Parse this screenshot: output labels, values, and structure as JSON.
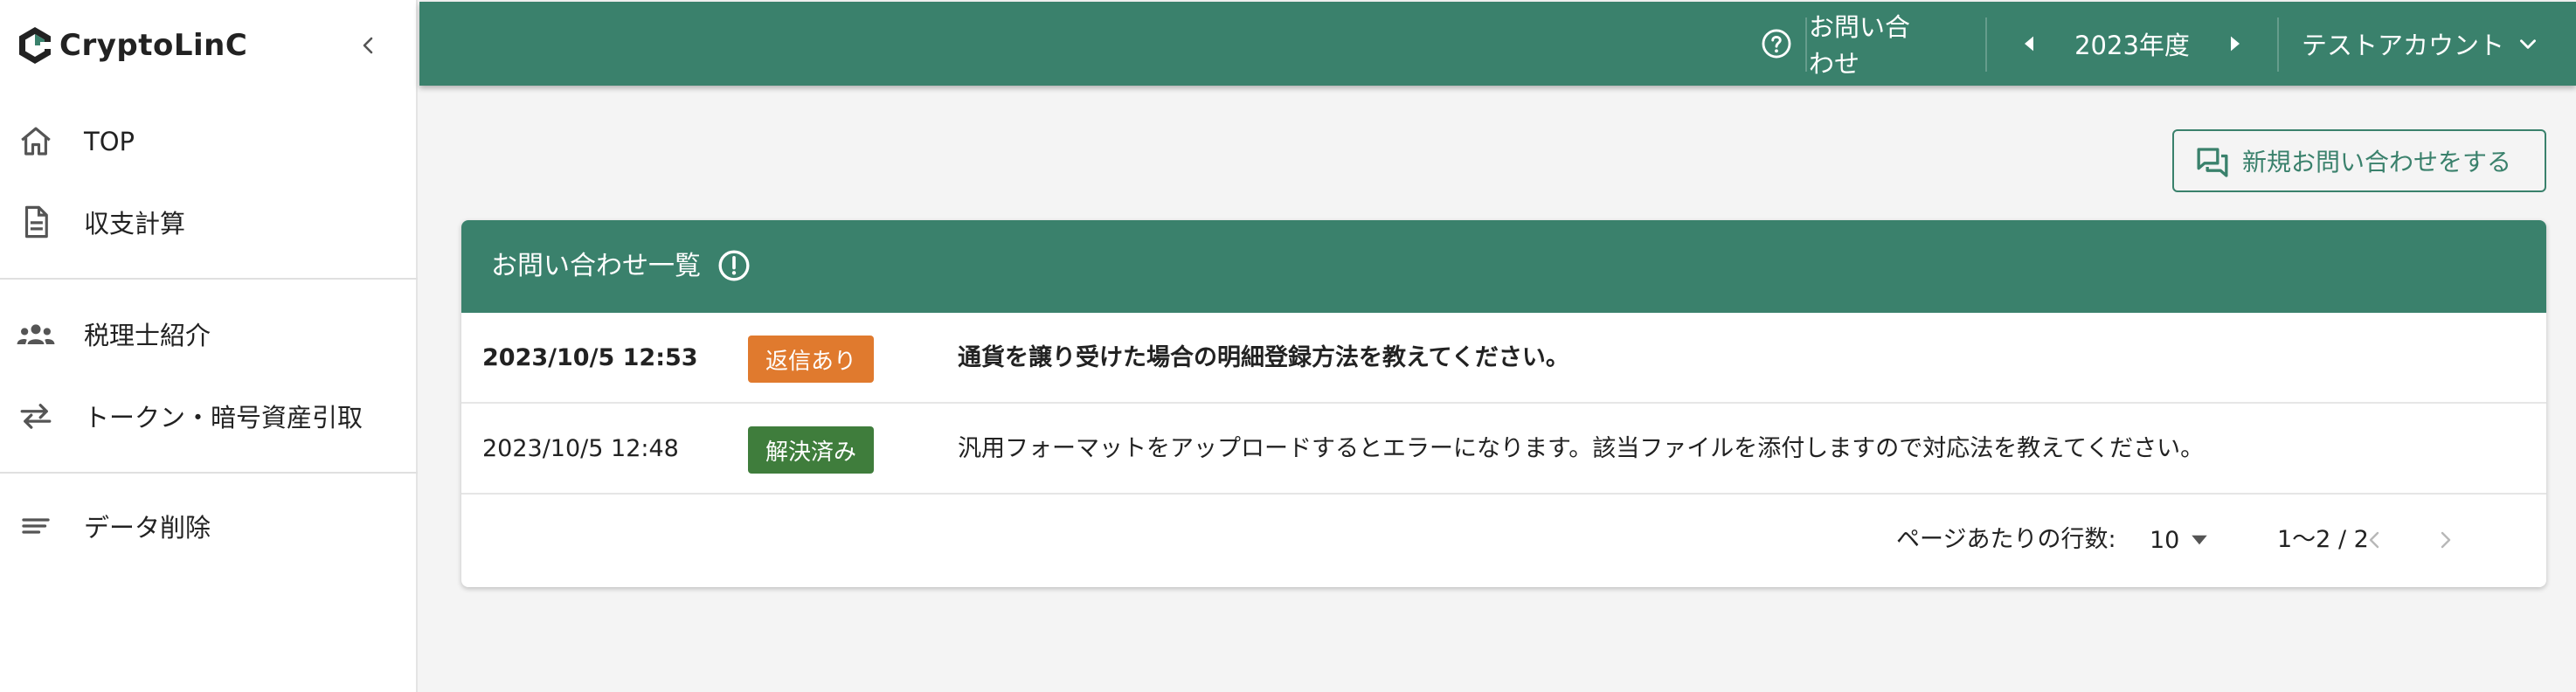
{
  "sidebar": {
    "logo_text": "CryptoLinC",
    "items": [
      {
        "label": "TOP",
        "icon": "home-icon"
      },
      {
        "label": "収支計算",
        "icon": "document-icon"
      },
      {
        "label": "税理士紹介",
        "icon": "people-icon"
      },
      {
        "label": "トークン・暗号資産引取",
        "icon": "swap-arrows-icon"
      },
      {
        "label": "データ削除",
        "icon": "lines-icon"
      }
    ]
  },
  "header": {
    "help_icon": "help-circle-icon",
    "contact_label": "お問い合わせ",
    "year_label": "2023年度",
    "account_label": "テストアカウント"
  },
  "main": {
    "new_inquiry_label": "新規お問い合わせをする",
    "list_title": "お問い合わせ一覧",
    "rows": [
      {
        "date": "2023/10/5 12:53",
        "status": "返信あり",
        "subject": "通貨を譲り受けた場合の明細登録方法を教えてください。"
      },
      {
        "date": "2023/10/5 12:48",
        "status": "解決済み",
        "subject": "汎用フォーマットをアップロードするとエラーになります。該当ファイルを添付しますので対応法を教えてください。"
      }
    ],
    "pagination": {
      "rows_per_page_label": "ページあたりの行数:",
      "rows_per_page": "10",
      "range": "1〜2 / 2"
    }
  },
  "colors": {
    "brand": "#3a816c",
    "badge_replied": "#e07a2e",
    "badge_resolved": "#3f7d3c"
  }
}
